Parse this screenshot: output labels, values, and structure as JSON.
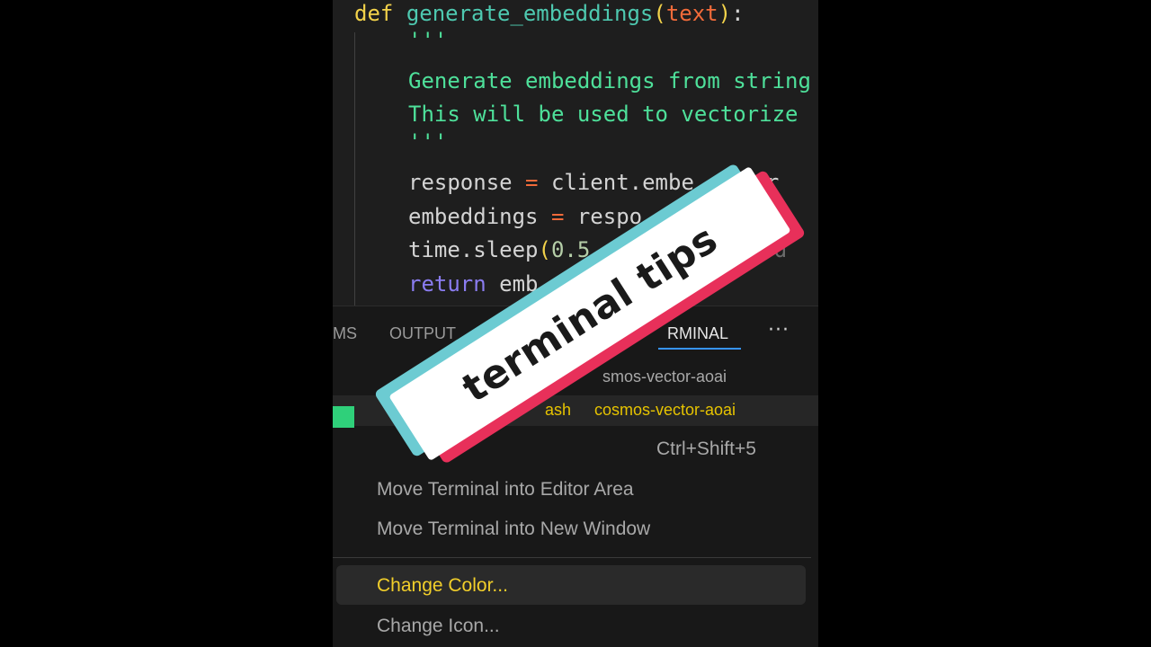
{
  "editor": {
    "lines": {
      "def_kw": "def",
      "fn_name": "generate_embeddings",
      "open_paren": "(",
      "param": "text",
      "close_paren": ")",
      "colon": ":",
      "doc_open": "'''",
      "doc_line1": "Generate embeddings from string",
      "doc_line2": "This will be used to vectorize",
      "doc_close": "'''",
      "resp_lhs": "response ",
      "resp_eq": "=",
      "resp_rhs": " client.embe",
      "resp_tail": "r",
      "emb_lhs": "embeddings ",
      "emb_eq": "=",
      "emb_rhs": " respo",
      "sleep_fn": "time.sleep",
      "sleep_open": "(",
      "sleep_num": "0.5",
      "sleep_tail": "od",
      "ret_kw": "return",
      "ret_rhs": " emb"
    }
  },
  "panel": {
    "tabs": {
      "problems": "MS",
      "output": "OUTPUT",
      "terminal": "RMINAL",
      "more": "···"
    },
    "terminals": [
      {
        "name": "",
        "folder": "smos-vector-aoai"
      },
      {
        "name": "ash",
        "folder": "cosmos-vector-aoai"
      }
    ],
    "menu": {
      "split_label": "",
      "split_shortcut": "Ctrl+Shift+5",
      "move_editor": "Move Terminal into Editor Area",
      "move_window": "Move Terminal into New Window",
      "change_color": "Change Color...",
      "change_icon": "Change Icon..."
    }
  },
  "sticker": {
    "text": "terminal tips"
  },
  "colors": {
    "sticker_cyan": "#6ccbd2",
    "sticker_red": "#e8305a",
    "highlight_yellow": "#f2cf2a"
  }
}
